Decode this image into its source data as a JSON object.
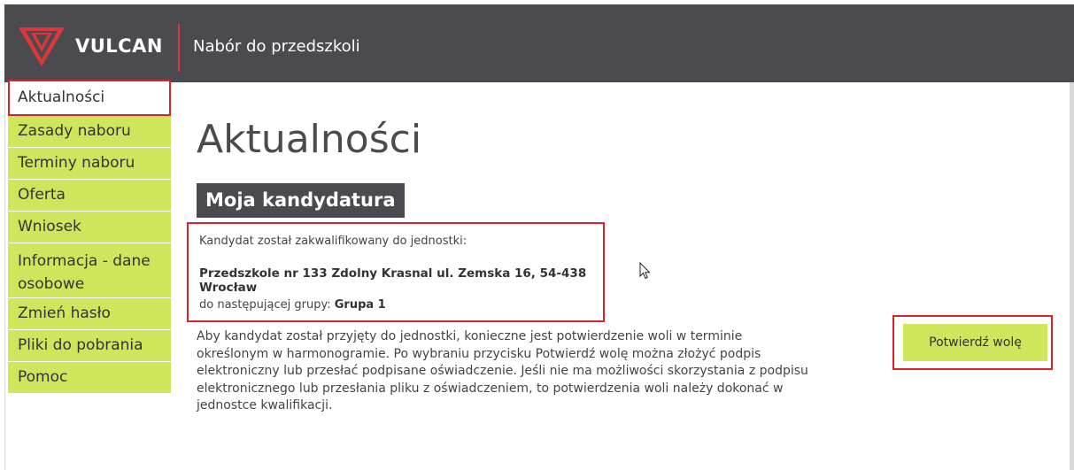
{
  "header": {
    "logo_text": "VULCAN",
    "title": "Nabór do przedszkoli"
  },
  "sidebar": {
    "items": [
      {
        "label": "Aktualności",
        "active": true
      },
      {
        "label": "Zasady naboru"
      },
      {
        "label": "Terminy naboru"
      },
      {
        "label": "Oferta"
      },
      {
        "label": "Wniosek"
      },
      {
        "label": "Informacja - dane osobowe"
      },
      {
        "label": "Zmień hasło"
      },
      {
        "label": "Pliki do pobrania"
      },
      {
        "label": "Pomoc"
      }
    ]
  },
  "main": {
    "title": "Aktualności",
    "section_heading": "Moja kandydatura",
    "qualified_text": "Kandydat został zakwalifikowany do jednostki:",
    "unit": "Przedszkole nr 133 Zdolny Krasnal ul. Zemska 16, 54-438 Wrocław",
    "group_prefix": "do następującej grupy:",
    "group_name": "Grupa 1",
    "info_text": "Aby kandydat został przyjęty do jednostki, konieczne jest potwierdzenie woli w terminie określonym w harmonogramie. Po wybraniu przycisku Potwierdź wolę można złożyć podpis elektroniczny lub przesłać podpisane oświadczenie. Jeśli nie ma możliwości skorzystania z podpisu elektronicznego lub przesłania pliku z oświadczeniem, to potwierdzenia woli należy dokonać w jednostce kwalifikacji.",
    "confirm_button": "Potwierdź wolę"
  },
  "colors": {
    "header_bg": "#4a4a4f",
    "accent_green": "#cfe65c",
    "highlight_red": "#e0202a",
    "logo_red": "#e0353a"
  },
  "icons": [
    "vulcan-logo-icon",
    "mouse-pointer-icon"
  ]
}
